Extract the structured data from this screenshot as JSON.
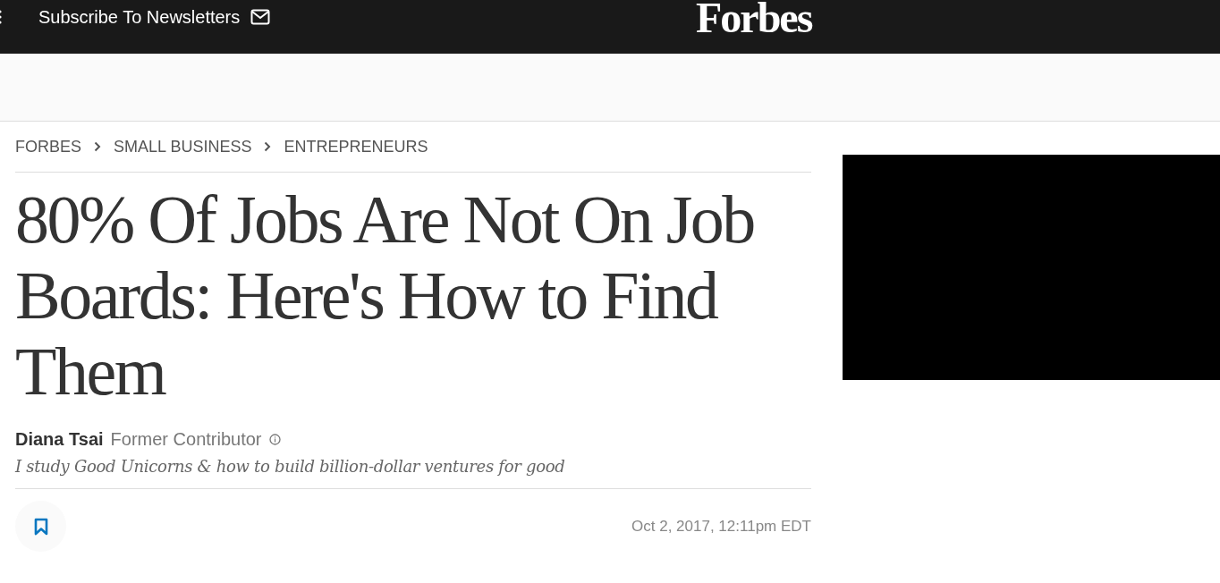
{
  "topbar": {
    "subscribe": "Subscribe To Newsletters",
    "logo": "Forbes"
  },
  "breadcrumbs": [
    "FORBES",
    "SMALL BUSINESS",
    "ENTREPRENEURS"
  ],
  "headline": "80% Of Jobs Are Not On Job Boards: Here's How to Find Them",
  "author": {
    "name": "Diana Tsai",
    "role": "Former Contributor",
    "bio": "I study Good Unicorns & how to build billion-dollar ventures for good"
  },
  "date": "Oct 2, 2017, 12:11pm EDT"
}
